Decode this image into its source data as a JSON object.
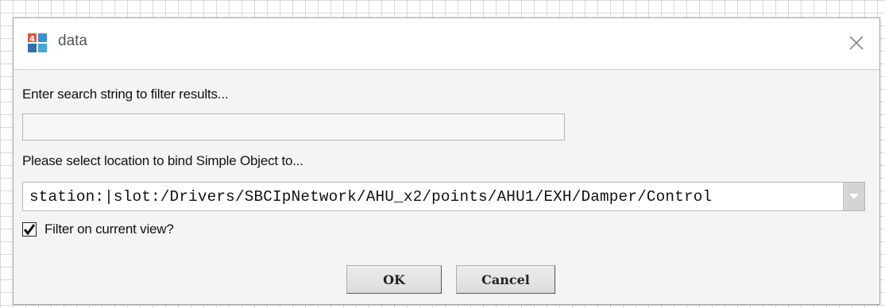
{
  "dialog": {
    "title": "data",
    "search_label": "Enter search string to filter results...",
    "search_value": "",
    "location_label": "Please select location to bind Simple Object to...",
    "location_value": "station:|slot:/Drivers/SBCIpNetwork/AHU_x2/points/AHU1/EXH/Damper/Control",
    "filter_label": "Filter on current view?",
    "filter_checked": true,
    "ok_label": "OK",
    "cancel_label": "Cancel"
  },
  "icons": {
    "app": "niagara-4-icon",
    "close": "close-icon",
    "dropdown": "chevron-down-icon",
    "check": "checkmark-icon"
  },
  "colors": {
    "dialog_bg": "#f4f4f4",
    "titlebar_bg": "#ffffff",
    "grid_line": "#d6d9de",
    "button_bg": "#e6e6e6"
  }
}
